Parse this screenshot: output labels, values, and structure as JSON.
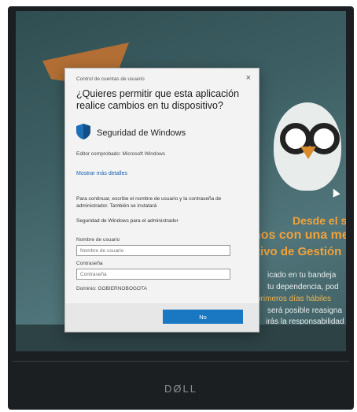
{
  "colors": {
    "screen_bg": "#3d5f63",
    "accent_orange": "#f3a23a",
    "primary_button": "#1a78c2",
    "link": "#1a5fb4"
  },
  "background": {
    "headline_line1": "Desde el sáb",
    "headline_line2": "nos con una me",
    "headline_line3": "tivo de Gestión",
    "body_line1": "icado en tu bandeja",
    "body_line2": "tu dependencia, pod",
    "body_line3": "primeros días hábiles",
    "body_line4": "será posible reasigna",
    "body_line5": "irás la responsabilidad"
  },
  "dialog": {
    "title": "Control de cuentas de usuario",
    "close_glyph": "×",
    "question": "¿Quieres permitir que esta aplicación realice cambios en tu dispositivo?",
    "shield_icon": "shield-icon",
    "app_name": "Seguridad de Windows",
    "publisher": "Editor comprobado: Microsoft Windows",
    "details_link": "Mostrar más detalles",
    "instructions": "Para continuar, escribe el nombre de usuario y la contraseña de administrador. También se instalará",
    "admin_label": "Seguridad de Windows para el administrador",
    "username_label": "Nombre de usuario",
    "username_placeholder": "Nombre de usuario",
    "password_label": "Contraseña",
    "password_placeholder": "Contraseña",
    "domain": "Dominio: GOBIERNOBOGOTA",
    "yes_button": "No"
  },
  "monitor": {
    "brand": "DØLL"
  }
}
